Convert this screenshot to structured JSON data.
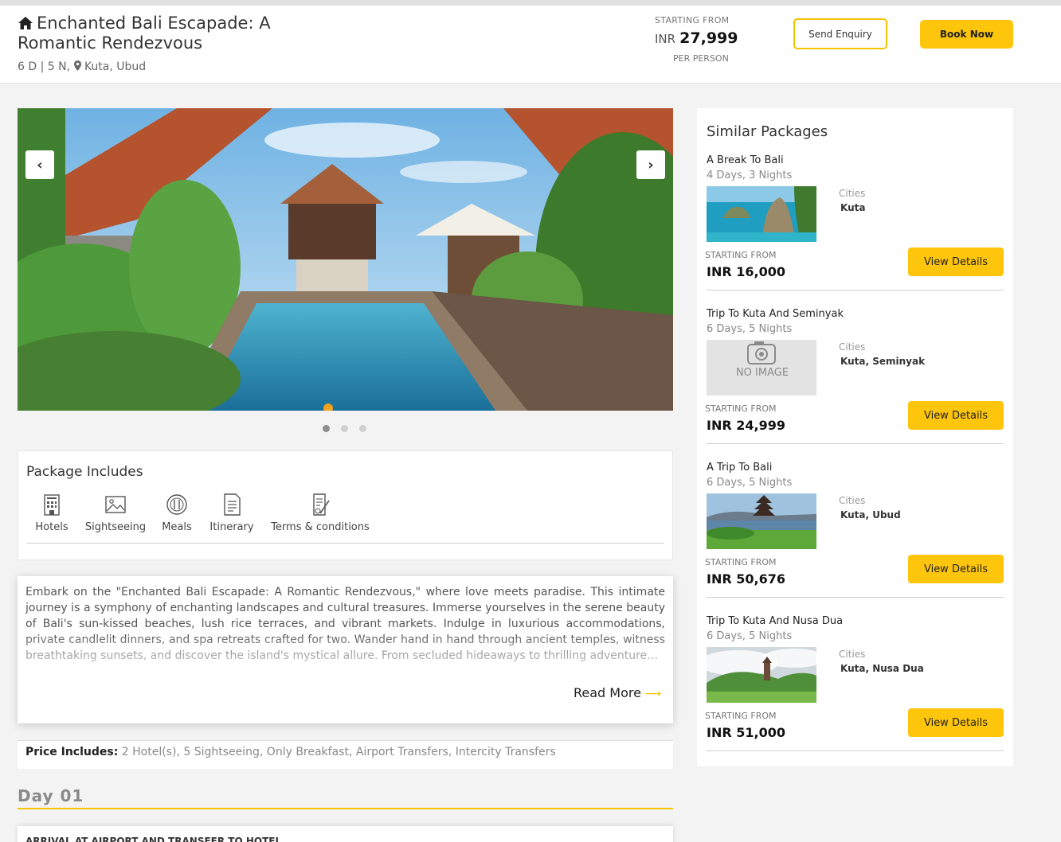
{
  "header": {
    "title": "Enchanted Bali Escapade: A Romantic Rendezvous",
    "duration": "6 D | 5 N,",
    "location": "Kuta, Ubud",
    "starting_from_label": "STARTING FROM",
    "currency": "INR",
    "price": "27,999",
    "per_person_label": "PER PERSON",
    "enquiry_label": "Send Enquiry",
    "book_label": "Book Now"
  },
  "carousel": {
    "prev_label": "‹",
    "next_label": "›",
    "slide_count": 3,
    "active_slide": 1
  },
  "package_includes": {
    "title": "Package Includes",
    "items": [
      {
        "label": "Hotels",
        "icon": "hotel-icon"
      },
      {
        "label": "Sightseeing",
        "icon": "image-icon"
      },
      {
        "label": "Meals",
        "icon": "meals-icon"
      },
      {
        "label": "Itinerary",
        "icon": "document-icon"
      },
      {
        "label": "Terms & conditions",
        "icon": "terms-icon"
      }
    ]
  },
  "description": {
    "text": "Embark on the \"Enchanted Bali Escapade: A Romantic Rendezvous,\" where love meets paradise. This intimate journey is a symphony of enchanting landscapes and cultural treasures. Immerse yourselves in the serene beauty of Bali's sun-kissed beaches, lush rice terraces, and vibrant markets. Indulge in luxurious accommodations, private candlelit dinners, and spa retreats crafted for two. Wander hand in hand through ancient temples, witness breathtaking sunsets, and discover the island's mystical allure. From secluded hideaways to thrilling adventure…",
    "read_more_label": "Read More",
    "read_more_arrow": "⟶"
  },
  "price_includes": {
    "label": "Price Includes:",
    "text": "2 Hotel(s), 5 Sightseeing, Only Breakfast, Airport Transfers, Intercity Transfers"
  },
  "itinerary": {
    "day_label": "Day 01",
    "first_activity": "ARRIVAL AT AIRPORT AND TRANSFER TO HOTEL"
  },
  "similar": {
    "title": "Similar Packages",
    "cities_label": "Cities",
    "starting_from_label": "STARTING FROM",
    "view_label": "View Details",
    "packages": [
      {
        "name": "A Break To Bali",
        "duration": "4 Days, 3 Nights",
        "cities": "Kuta",
        "price": "INR 16,000"
      },
      {
        "name": "Trip To Kuta And Seminyak",
        "duration": "6 Days, 5 Nights",
        "cities": "Kuta, Seminyak",
        "price": "INR 24,999",
        "no_image_text": "NO IMAGE"
      },
      {
        "name": "A Trip To Bali",
        "duration": "6 Days, 5 Nights",
        "cities": "Kuta, Ubud",
        "price": "INR 50,676"
      },
      {
        "name": "Trip To Kuta And Nusa Dua",
        "duration": "6 Days, 5 Nights",
        "cities": "Kuta, Nusa Dua",
        "price": "INR 51,000"
      }
    ]
  },
  "colors": {
    "accent": "#fdc50c",
    "page_bg": "#f3f3f3"
  }
}
